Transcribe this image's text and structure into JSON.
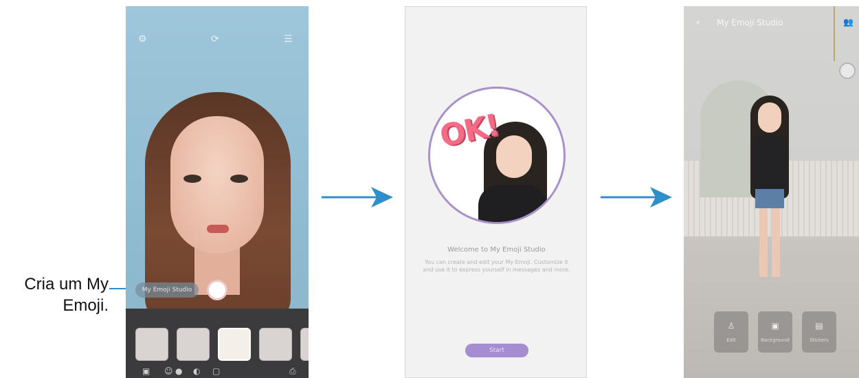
{
  "callout": {
    "line1": "Cria um My",
    "line2": "Emoji."
  },
  "screen1": {
    "create_button_label": "My Emoji Studio",
    "top_icons": [
      "settings-icon",
      "flip-icon",
      "menu-icon"
    ],
    "tray_icons": [
      "gallery-icon",
      "emoji-icon",
      "sticker-icon",
      "mask-icon",
      "more-icon"
    ]
  },
  "screen2": {
    "badge_text": "OK!",
    "title": "Welcome to My Emoji Studio",
    "body": "You can create and edit your My Emoji. Customize it and use it to express yourself in messages and more.",
    "start_label": "Start"
  },
  "screen3": {
    "title": "My Emoji Studio",
    "menu": [
      {
        "icon": "person-icon",
        "label": "Edit"
      },
      {
        "icon": "image-icon",
        "label": "Background"
      },
      {
        "icon": "sticker-icon",
        "label": "Stickers"
      }
    ]
  },
  "colors": {
    "accent_blue": "#2f8fc8",
    "start_purple": "#a68cd0"
  }
}
